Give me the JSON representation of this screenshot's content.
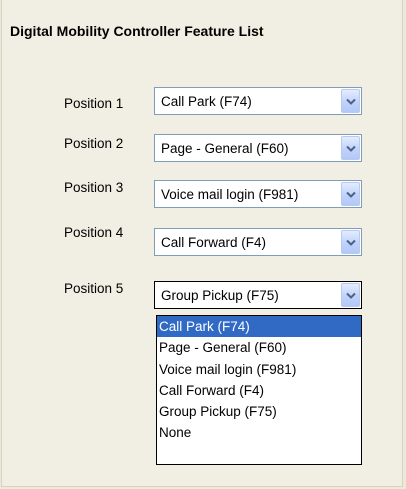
{
  "title": "Digital Mobility Controller Feature List",
  "positions": [
    {
      "label": "Position 1",
      "value": "Call Park (F74)"
    },
    {
      "label": "Position 2",
      "value": "Page - General (F60)"
    },
    {
      "label": "Position 3",
      "value": "Voice mail login (F981)"
    },
    {
      "label": "Position 4",
      "value": "Call Forward (F4)"
    },
    {
      "label": "Position 5",
      "value": "Group Pickup (F75)"
    }
  ],
  "dropdown": {
    "options": [
      "Call Park (F74)",
      "Page - General (F60)",
      "Voice mail login (F981)",
      "Call Forward (F4)",
      "Group Pickup (F75)",
      "None"
    ],
    "highlighted": "Call Park (F74)"
  },
  "colors": {
    "background": "#f1efe3",
    "highlight": "#316ac5",
    "combo_border": "#7f9db9"
  },
  "icons": {
    "dropdown_arrow": "chevron-down-icon"
  }
}
